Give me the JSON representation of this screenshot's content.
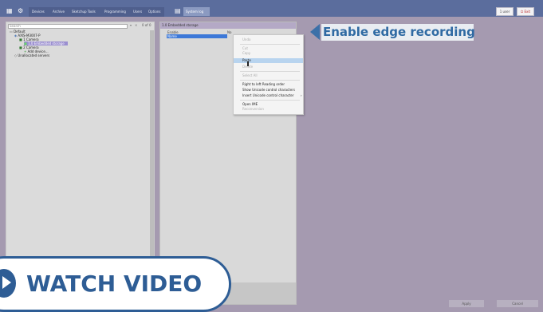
{
  "toolbar": {
    "menu": [
      "Devices",
      "Archive",
      "Sketchup Tools",
      "Programming",
      "Users",
      "Options"
    ],
    "system_log": "System log",
    "exit_btn": "Exit",
    "user_btn": "1 user"
  },
  "left_panel": {
    "search_placeholder": "Search",
    "count": "0 of 0",
    "tree": [
      "Default",
      "AXIS-M3007-P",
      "1 Camera",
      "1.0 Embedded storage",
      "2 Camera",
      "Add device...",
      "Unallocated servers"
    ]
  },
  "mid_panel": {
    "header": "1.0 Embedded storage",
    "col_enable": "Enable",
    "col_no": "No",
    "row_value": "Name"
  },
  "context_menu": {
    "items": [
      "Undo",
      "Cut",
      "Copy",
      "Paste",
      "Delete",
      "Select All",
      "Right to left Reading order",
      "Show Unicode control characters",
      "Insert Unicode control character",
      "Open IME",
      "Reconversion"
    ]
  },
  "callout": {
    "text": "Enable edge recording"
  },
  "watch_video": {
    "text": "WATCH VIDEO"
  },
  "bottom": {
    "apply": "Apply",
    "cancel": "Cancel"
  },
  "colors": {
    "accent": "#2e5d95",
    "titlebar": "#5b6d9d",
    "background": "#a59ab0"
  }
}
